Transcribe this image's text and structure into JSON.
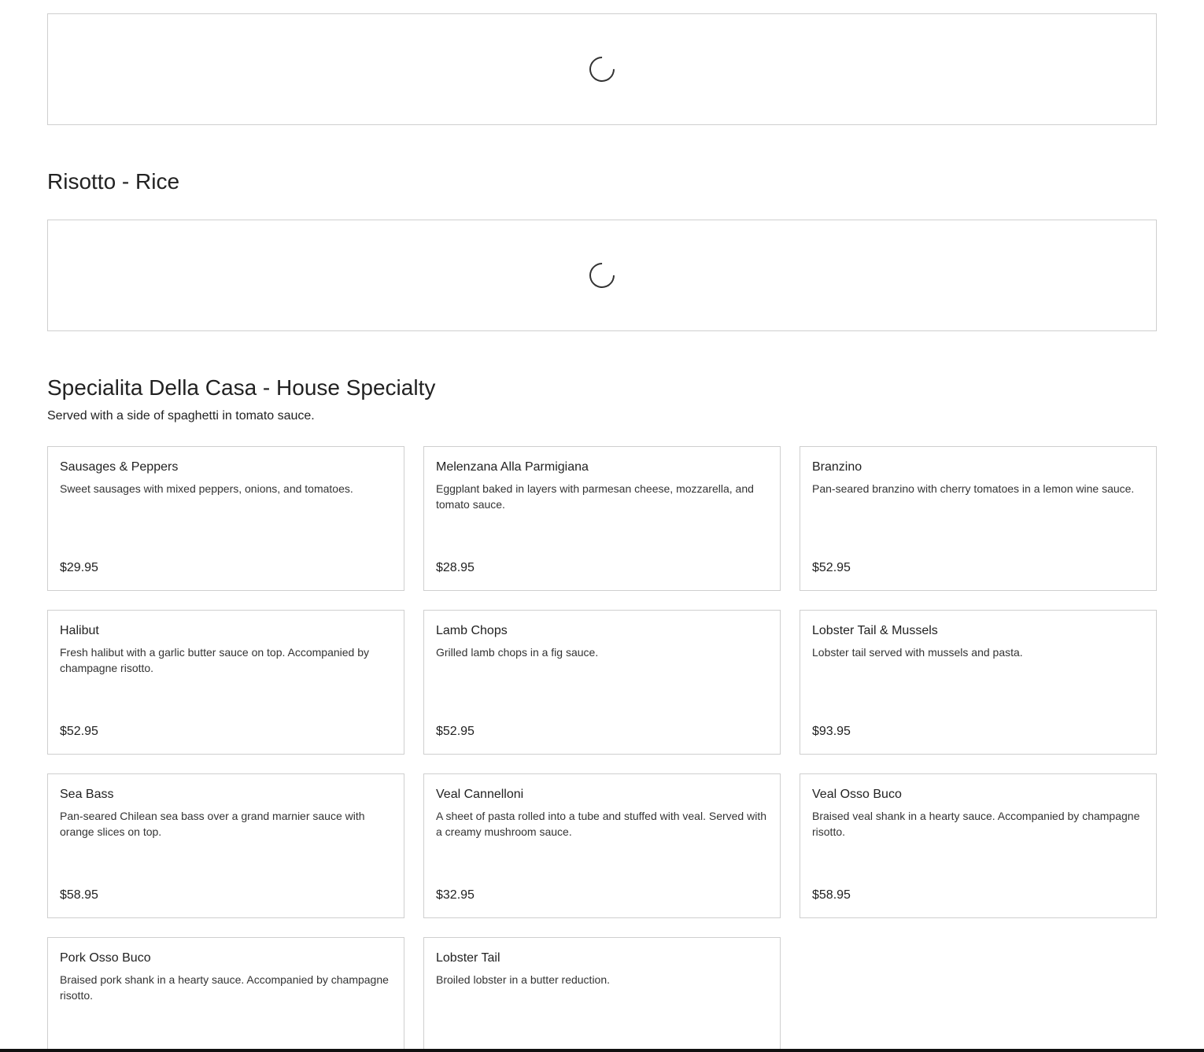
{
  "sections": [
    {
      "title": "Risotto - Rice"
    },
    {
      "title": "Specialita Della Casa - House Specialty",
      "description": "Served with a side of spaghetti in tomato sauce."
    }
  ],
  "items": [
    {
      "name": "Sausages & Peppers",
      "description": "Sweet sausages with mixed peppers, onions, and tomatoes.",
      "price": "$29.95"
    },
    {
      "name": "Melenzana Alla Parmigiana",
      "description": "Eggplant baked in layers with parmesan cheese, mozzarella, and tomato sauce.",
      "price": "$28.95"
    },
    {
      "name": "Branzino",
      "description": "Pan-seared branzino with cherry tomatoes in a lemon wine sauce.",
      "price": "$52.95"
    },
    {
      "name": "Halibut",
      "description": "Fresh halibut with a garlic butter sauce on top. Accompanied by champagne risotto.",
      "price": "$52.95"
    },
    {
      "name": "Lamb Chops",
      "description": "Grilled lamb chops in a fig sauce.",
      "price": "$52.95"
    },
    {
      "name": "Lobster Tail & Mussels",
      "description": "Lobster tail served with mussels and pasta.",
      "price": "$93.95"
    },
    {
      "name": "Sea Bass",
      "description": "Pan-seared Chilean sea bass over a grand marnier sauce with orange slices on top.",
      "price": "$58.95"
    },
    {
      "name": "Veal Cannelloni",
      "description": "A sheet of pasta rolled into a tube and stuffed with veal. Served with a creamy mushroom sauce.",
      "price": "$32.95"
    },
    {
      "name": "Veal Osso Buco",
      "description": "Braised veal shank in a hearty sauce. Accompanied by champagne risotto.",
      "price": "$58.95"
    },
    {
      "name": "Pork Osso Buco",
      "description": "Braised pork shank in a hearty sauce. Accompanied by champagne risotto.",
      "price": ""
    },
    {
      "name": "Lobster Tail",
      "description": "Broiled lobster in a butter reduction.",
      "price": ""
    }
  ]
}
